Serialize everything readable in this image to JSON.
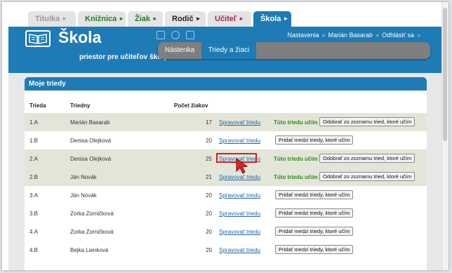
{
  "top_tabs": [
    {
      "label": "Titulka",
      "color": "#9a9a9a"
    },
    {
      "label": "Knižnica",
      "color": "#2a7a2a"
    },
    {
      "label": "Žiak",
      "color": "#2a7a2a"
    },
    {
      "label": "Rodič",
      "color": "#222222"
    },
    {
      "label": "Učiteľ",
      "color": "#a0285a"
    },
    {
      "label": "Škola",
      "color": "#ffffff",
      "active": true
    }
  ],
  "tab_arrow": "►",
  "header": {
    "title": "Škola",
    "subtitle": "priestor pre učiteľov školy",
    "settings": "Nastavenia",
    "user": "Marián Basarab",
    "logout": "Odhlásiť sa",
    "sep": "»"
  },
  "subnav": [
    {
      "label": "Nástenka"
    },
    {
      "label": "Triedy a žiaci",
      "active": true
    }
  ],
  "section_title": "Moje triedy",
  "columns": {
    "class": "Trieda",
    "teacher": "Triedny",
    "count": "Počet žiakov"
  },
  "rows": [
    {
      "class": "1.A",
      "teacher": "Marián Basarab",
      "count": "17",
      "manage": "Spravovať triedu",
      "status": "Túto triedu učím",
      "action": "Odobrať zo zoznamu tried, ktoré učím"
    },
    {
      "class": "1.B",
      "teacher": "Denisa Olejková",
      "count": "20",
      "manage": "Spravovať triedu",
      "status": "",
      "action": "Pridať medzi triedy, ktoré učím"
    },
    {
      "class": "2.A",
      "teacher": "Denisa Olejková",
      "count": "25",
      "manage": "Spravovať triedu",
      "status": "Túto triedu učím",
      "action": "Odobrať zo zoznamu tried, ktoré učím"
    },
    {
      "class": "2.B",
      "teacher": "Ján Novák",
      "count": "21",
      "manage": "Spravovať triedu",
      "status": "Túto triedu učím",
      "action": "Odobrať zo zoznamu tried, ktoré učím"
    },
    {
      "class": "3.A",
      "teacher": "Ján Novák",
      "count": "20",
      "manage": "Spravovať triedu",
      "status": "",
      "action": "Pridať medzi triedy, ktoré učím"
    },
    {
      "class": "3.B",
      "teacher": "Zorka Zorničková",
      "count": "20",
      "manage": "Spravovať triedu",
      "status": "",
      "action": "Pridať medzi triedy, ktoré učím"
    },
    {
      "class": "4.A",
      "teacher": "Zorka Zorničková",
      "count": "20",
      "manage": "Spravovať triedu",
      "status": "",
      "action": "Pridať medzi triedy, ktoré učím"
    },
    {
      "class": "4.B",
      "teacher": "Bejka Lienková",
      "count": "20",
      "manage": "Spravovať triedu",
      "status": "",
      "action": "Pridať medzi triedy, ktoré učím"
    }
  ],
  "colors": {
    "accent": "#1e7bb6",
    "shade": "#e4e5d9",
    "highlight": "#d21f1f",
    "cursor": "#e02424"
  }
}
